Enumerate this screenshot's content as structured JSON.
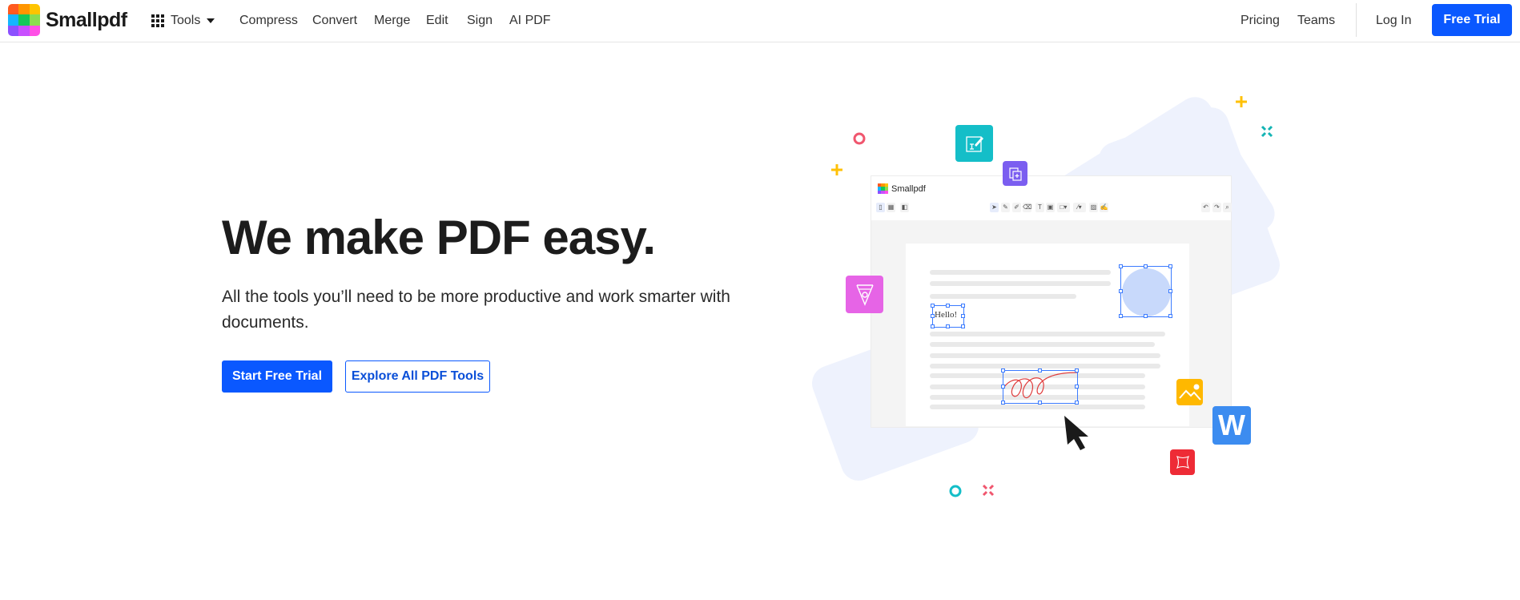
{
  "brand": {
    "name": "Smallpdf",
    "logo_colors": [
      "#ff5a1f",
      "#ff9500",
      "#ffc400",
      "#14b5ff",
      "#14c85a",
      "#8cdc50",
      "#8c50ff",
      "#c850ff",
      "#ff50e6"
    ]
  },
  "nav": {
    "tools_label": "Tools",
    "links": [
      "Compress",
      "Convert",
      "Merge",
      "Edit",
      "Sign",
      "AI PDF"
    ],
    "right_links": [
      "Pricing",
      "Teams"
    ],
    "login_label": "Log In",
    "cta_label": "Free Trial"
  },
  "hero": {
    "title": "We make PDF easy.",
    "subtitle": "All the tools you’ll need to be more productive and work smarter with documents.",
    "primary_button": "Start Free Trial",
    "secondary_button": "Explore All PDF Tools"
  },
  "illustration": {
    "window_title": "Smallpdf",
    "sample_text": "Hello!",
    "word_icon_letter": "W",
    "icons": [
      "edit-pdf-icon",
      "merge-pdf-icon",
      "sign-pen-icon",
      "image-icon",
      "word-icon",
      "crop-icon",
      "cursor-icon"
    ]
  },
  "colors": {
    "accent": "#0a58ff",
    "teal": "#14bec8",
    "purple": "#7b5ef0",
    "pink": "#e664e6",
    "yellow": "#ffb800",
    "word_blue": "#3c8cf0",
    "red": "#ee2b36"
  }
}
